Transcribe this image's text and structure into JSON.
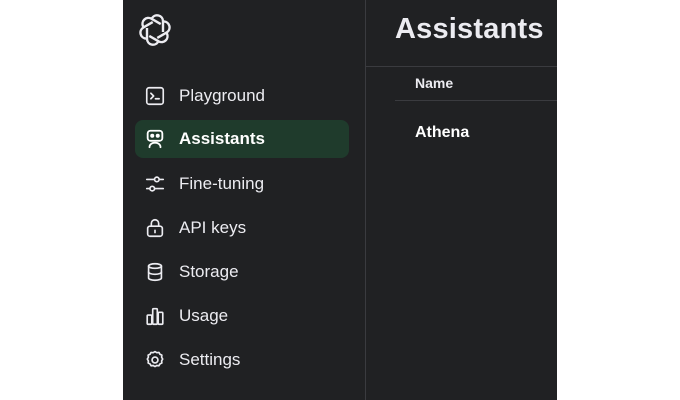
{
  "sidebar": {
    "logo_icon": "openai-logo-icon",
    "items": [
      {
        "label": "Playground",
        "icon": "terminal-icon",
        "active": false
      },
      {
        "label": "Assistants",
        "icon": "robot-icon",
        "active": true
      },
      {
        "label": "Fine-tuning",
        "icon": "sliders-icon",
        "active": false
      },
      {
        "label": "API keys",
        "icon": "lock-icon",
        "active": false
      },
      {
        "label": "Storage",
        "icon": "database-icon",
        "active": false
      },
      {
        "label": "Usage",
        "icon": "bar-chart-icon",
        "active": false
      },
      {
        "label": "Settings",
        "icon": "gear-icon",
        "active": false
      }
    ]
  },
  "main": {
    "title": "Assistants",
    "table": {
      "columns": [
        "Name"
      ],
      "rows": [
        {
          "name": "Athena"
        }
      ]
    }
  },
  "colors": {
    "background": "#202123",
    "active_item": "#1f3b2c",
    "text": "#ececf1",
    "divider": "#3a3b3f"
  }
}
